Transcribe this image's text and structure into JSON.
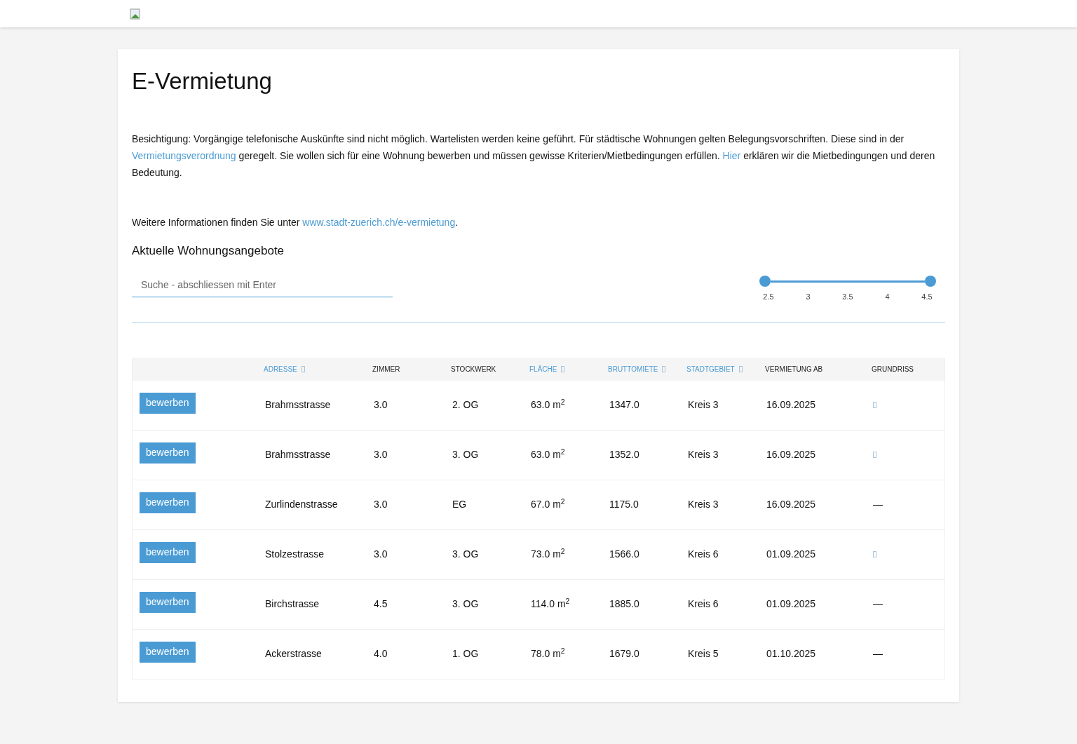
{
  "title": "E-Vermietung",
  "intro": "Besichtigung: Vorgängige telefonische Auskünfte sind nicht möglich. Wartelisten werden keine geführt. Für städtische Wohnungen gelten Belegungsvorschriften. Diese sind in der ",
  "intro_link1": "Vermietungsverordnung",
  "intro_mid": " geregelt. Sie wollen sich für eine Wohnung bewerben und müssen gewisse Kriterien/Mietbedingungen erfüllen. ",
  "intro_link2": "Hier",
  "intro_end": " erklären wir die Mietbedingungen und deren Bedeutung.",
  "info": "Weitere Informationen finden Sie unter ",
  "info_link": "www.stadt-zuerich.ch/e-vermietung",
  "info_end": ".",
  "section_title": "Aktuelle Wohnungsangebote",
  "search": {
    "placeholder": "Suche - abschliessen mit Enter"
  },
  "slider": {
    "low": {
      "level": 0
    },
    "high": {
      "level": 1
    },
    "ticks": [
      "2.5",
      "3",
      "3.5",
      "4",
      "4.5"
    ]
  },
  "columns": [
    {
      "sortable": false
    },
    {
      "label": "ADRESSE",
      "sortable": true
    },
    {
      "label": "ZIMMER",
      "sortable": false
    },
    {
      "label": "STOCKWERK",
      "sortable": false
    },
    {
      "label": "FLÄCHE",
      "sortable": true
    },
    {
      "label": "BRUTTOMIETE",
      "sortable": true
    },
    {
      "label": "STADTGEBIET",
      "sortable": true
    },
    {
      "label": "VERMIETUNG AB",
      "sortable": false
    },
    {
      "label": "GRUNDRISS",
      "sortable": false
    }
  ],
  "rows": [
    {
      "button": "bewerben",
      "address": "Brahmsstrasse",
      "rooms": "3.0",
      "floor": "2. OG",
      "area": "63.0 m$^{2}$",
      "rent": "1347.0",
      "district": "Kreis 3",
      "date": "16.09.2025",
      "plan": true
    },
    {
      "button": "bewerben",
      "address": "Brahmsstrasse",
      "rooms": "3.0",
      "floor": "3. OG",
      "area": "63.0 m$^{2}$",
      "rent": "1352.0",
      "district": "Kreis 3",
      "date": "16.09.2025",
      "plan": true
    },
    {
      "button": "bewerben",
      "address": "Zurlindenstrasse",
      "rooms": "3.0",
      "floor": "EG",
      "area": "67.0 m$^{2}$",
      "rent": "1175.0",
      "district": "Kreis 3",
      "date": "16.09.2025",
      "plan": false,
      "plan_text": "—"
    },
    {
      "button": "bewerben",
      "address": "Stolzestrasse",
      "rooms": "3.0",
      "floor": "3. OG",
      "area": "73.0 m$^{2}$",
      "rent": "1566.0",
      "district": "Kreis 6",
      "date": "01.09.2025",
      "plan": true
    },
    {
      "button": "bewerben",
      "address": "Birchstrasse",
      "rooms": "4.5",
      "floor": "3. OG",
      "area": "114.0 m$^{2}$",
      "rent": "1885.0",
      "district": "Kreis 6",
      "date": "01.09.2025",
      "plan": false,
      "plan_text": "—"
    },
    {
      "button": "bewerben",
      "address": "Ackerstrasse",
      "rooms": "4.0",
      "floor": "1. OG",
      "area": "78.0 m$^{2}$",
      "rent": "1679.0",
      "district": "Kreis 5",
      "date": "01.10.2025",
      "plan": false,
      "plan_text": "—"
    }
  ]
}
